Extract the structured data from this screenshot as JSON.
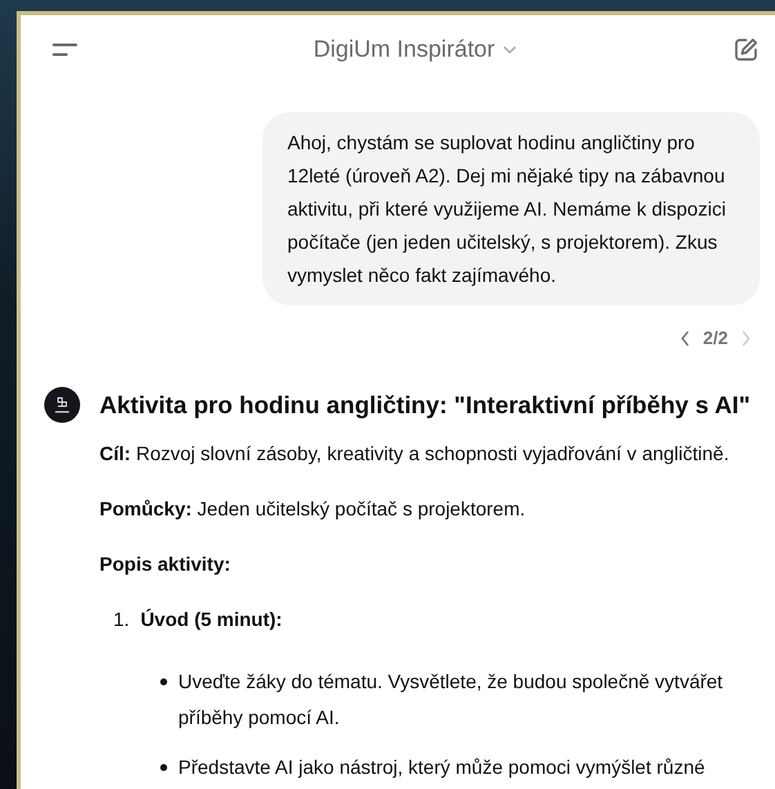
{
  "header": {
    "title": "DigiUm Inspirátor"
  },
  "user_message": {
    "text": "Ahoj, chystám se suplovat hodinu angličtiny pro 12leté (úroveň A2). Dej mi nějaké tipy na zábavnou aktivitu, při které využijeme AI. Nemáme k dispozici počítače (jen jeden učitelský, s projektorem). Zkus vymyslet něco fakt zajímavého.",
    "version": "2/2"
  },
  "assistant_message": {
    "heading": "Aktivita pro hodinu angličtiny: \"Interaktivní příběhy s AI\"",
    "paragraphs": [
      "**Cíl:** Rozvoj slovní zásoby, kreativity a schopnosti vyjadřování v angličtině.",
      "**Pomůcky:** Jeden učitelský počítač s projektorem.",
      "**Popis aktivity:**"
    ],
    "steps": [
      {
        "number": "1.",
        "title": "Úvod (5 minut):",
        "bullets": [
          "Uveďte žáky do tématu. Vysvětlete, že budou společně vytvářet příběhy pomocí AI.",
          "Představte AI jako nástroj, který může pomoci vymýšlet různé"
        ]
      }
    ]
  }
}
